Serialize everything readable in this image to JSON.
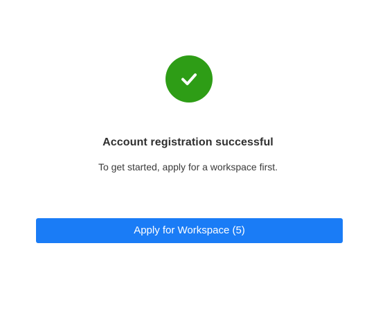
{
  "success": {
    "icon": "check-circle-icon",
    "icon_color": "#2e9d16",
    "title": "Account registration successful",
    "message": "To get started, apply for a workspace first."
  },
  "actions": {
    "apply_label": "Apply for Workspace (5)",
    "apply_color": "#1a7cf6"
  }
}
